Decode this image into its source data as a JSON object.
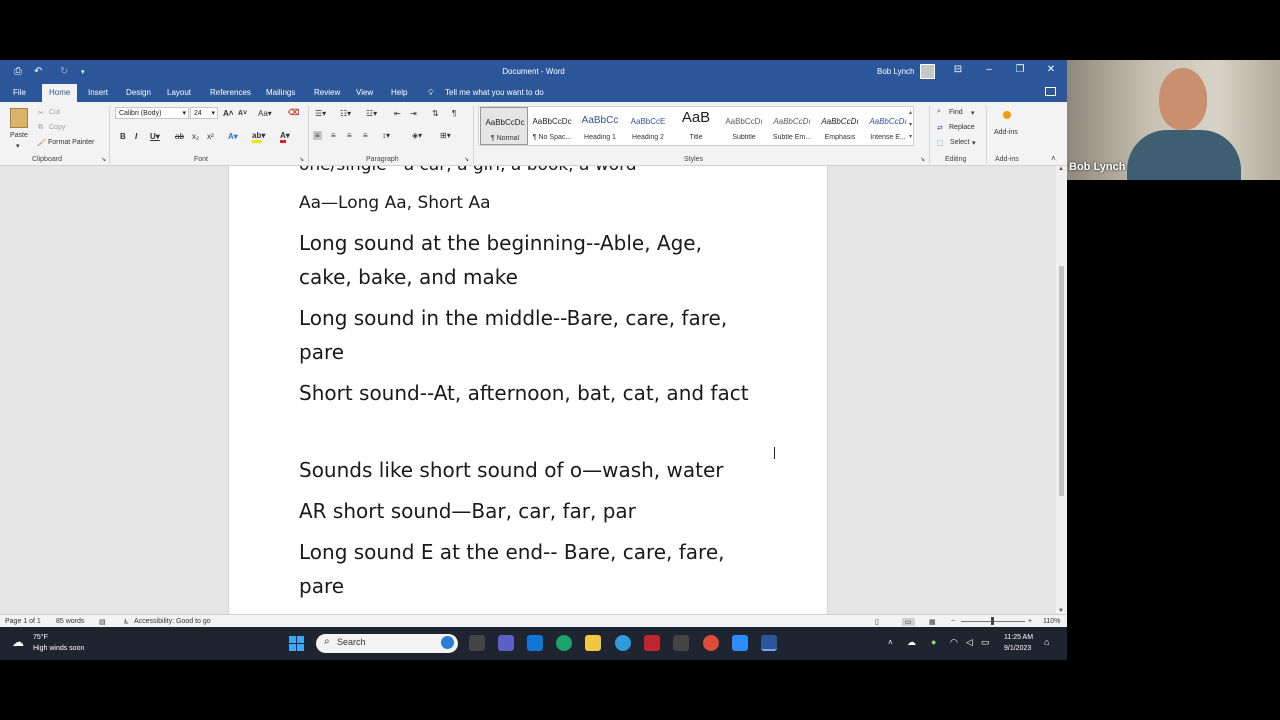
{
  "window": {
    "title": "Document - Word",
    "user_name": "Bob Lynch"
  },
  "tabs": [
    "File",
    "Home",
    "Insert",
    "Design",
    "Layout",
    "References",
    "Mailings",
    "Review",
    "View",
    "Help"
  ],
  "tell_me": "Tell me what you want to do",
  "ribbon": {
    "clipboard": {
      "paste": "Paste",
      "cut": "Cut",
      "copy": "Copy",
      "format_painter": "Format Painter",
      "label": "Clipboard"
    },
    "font": {
      "font_name": "Calibri (Body)",
      "font_size": "24",
      "label": "Font"
    },
    "paragraph": {
      "label": "Paragraph"
    },
    "styles": {
      "label": "Styles",
      "items": [
        {
          "sample": "AaBbCcDc",
          "name": "¶ Normal"
        },
        {
          "sample": "AaBbCcDc",
          "name": "¶ No Spac..."
        },
        {
          "sample": "AaBbCc",
          "name": "Heading 1"
        },
        {
          "sample": "AaBbCcE",
          "name": "Heading 2"
        },
        {
          "sample": "AaB",
          "name": "Title"
        },
        {
          "sample": "AaBbCcDı",
          "name": "Subtitle"
        },
        {
          "sample": "AaBbCcDı",
          "name": "Subtle Em..."
        },
        {
          "sample": "AaBbCcDı",
          "name": "Emphasis"
        },
        {
          "sample": "AaBbCcDı",
          "name": "Intense E..."
        }
      ]
    },
    "editing": {
      "find": "Find",
      "replace": "Replace",
      "select": "Select",
      "label": "Editing"
    },
    "addins": {
      "button": "Add-ins",
      "label": "Add-ins"
    }
  },
  "document": {
    "paragraphs": [
      "one/single—a car, a girl, a book, a word",
      "Aa—Long Aa, Short Aa",
      "Long sound at the beginning--Able, Age, cake, bake, and make",
      "Long sound in the middle--Bare, care, fare, pare",
      "Short sound--At, afternoon, bat, cat, and fact",
      "Sounds like short sound of o—wash, water",
      "AR short sound—Bar, car, far, par",
      "Long sound E at the end-- Bare, care, fare, pare"
    ]
  },
  "status": {
    "page": "Page 1 of 1",
    "words": "85 words",
    "accessibility": "Accessibility: Good to go",
    "zoom": "110%"
  },
  "taskbar": {
    "weather_temp": "75°F",
    "weather_desc": "High winds soon",
    "search_placeholder": "Search",
    "time": "11:25 AM",
    "date": "9/1/2023"
  },
  "webcam": {
    "name": "Bob Lynch"
  }
}
